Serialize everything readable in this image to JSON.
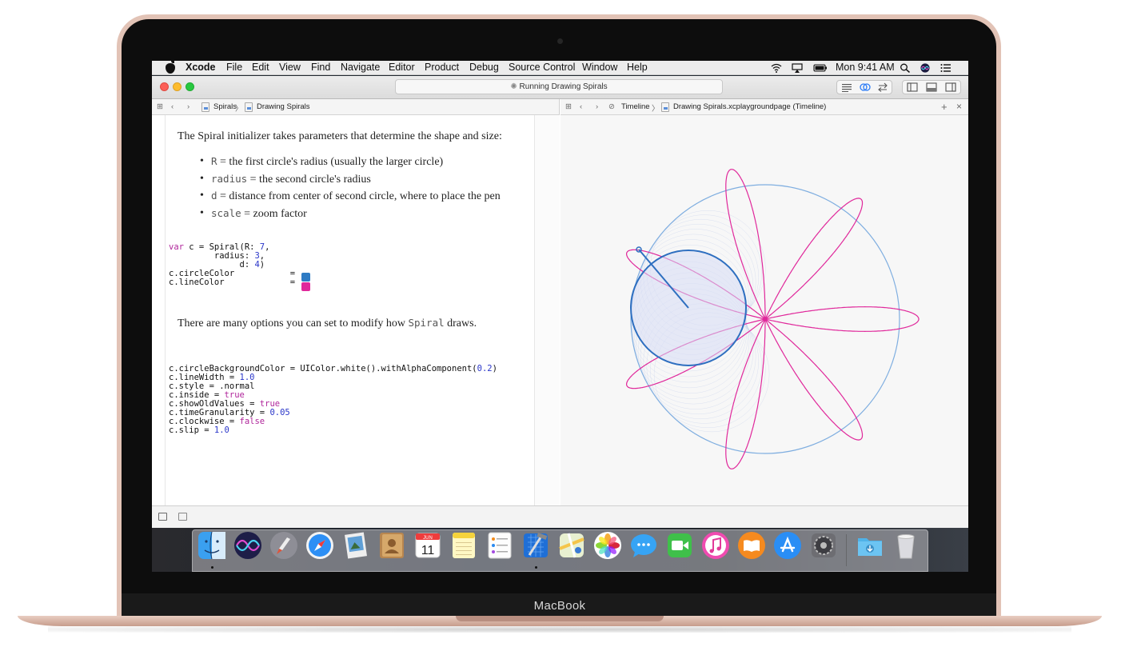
{
  "menubar": {
    "app": "Xcode",
    "items": [
      "File",
      "Edit",
      "View",
      "Find",
      "Navigate",
      "Editor",
      "Product",
      "Debug",
      "Source Control",
      "Window",
      "Help"
    ],
    "clock": "Mon 9:41 AM"
  },
  "toolbar": {
    "activity_text": "Running Drawing Spirals"
  },
  "editor_jump": {
    "crumb1": "Spirals",
    "sep": "〉",
    "crumb2": "Drawing Spirals"
  },
  "timeline_jump": {
    "crumb1": "Timeline",
    "sep": "〉",
    "crumb2": "Drawing Spirals.xcplaygroundpage (Timeline)"
  },
  "doc": {
    "intro": "The Spiral initializer takes parameters that determine the shape and size:",
    "bullets": [
      {
        "code": "R",
        "text": " = the first circle's radius (usually the larger circle)"
      },
      {
        "code": "radius",
        "text": " = the second circle's radius"
      },
      {
        "code": "d",
        "text": " = distance from center of second circle, where to place the pen"
      },
      {
        "code": "scale",
        "text": " = zoom factor"
      }
    ],
    "options_before": "There are many options you can set to modify how ",
    "options_code": "Spiral",
    "options_after": " draws."
  },
  "code_block_1": {
    "line1_kw": "var",
    "line1_pre": " c = Spiral(R: ",
    "line1_num": "7",
    "line1_post": ",",
    "line2_pre": "         radius: ",
    "line2_num": "3",
    "line2_post": ",",
    "line3_pre": "              d: ",
    "line3_num": "4",
    "line3_post": ")",
    "line4": "c.circleColor           = ",
    "line5": "c.lineColor             = "
  },
  "code_block_2": {
    "l1_pre": "c.circleBackgroundColor = UIColor.white().withAlphaComponent(",
    "l1_num": "0.2",
    "l1_post": ")",
    "l2_pre": "c.lineWidth = ",
    "l2_num": "1.0",
    "l3": "c.style = .normal",
    "l4_pre": "c.inside = ",
    "l4_kw": "true",
    "l5_pre": "c.showOldValues = ",
    "l5_kw": "true",
    "l6_pre": "c.timeGranularity = ",
    "l6_num": "0.05",
    "l7_pre": "c.clockwise = ",
    "l7_kw": "false",
    "l8_pre": "c.slip = ",
    "l8_num": "1.0"
  },
  "swatches": {
    "circle_color": "#2e7bc4",
    "line_color": "#e0289b"
  },
  "dock": {
    "calendar_month": "JUN",
    "calendar_day": "11",
    "apps": [
      "Finder",
      "Siri",
      "Launchpad",
      "Safari",
      "Preview",
      "Contacts",
      "Calendar",
      "Notes",
      "Reminders",
      "Xcode",
      "Maps",
      "Photos",
      "Messages",
      "FaceTime",
      "iTunes",
      "iBooks",
      "App Store",
      "System Preferences",
      "Downloads",
      "Trash"
    ]
  },
  "device": {
    "brand": "MacBook"
  }
}
